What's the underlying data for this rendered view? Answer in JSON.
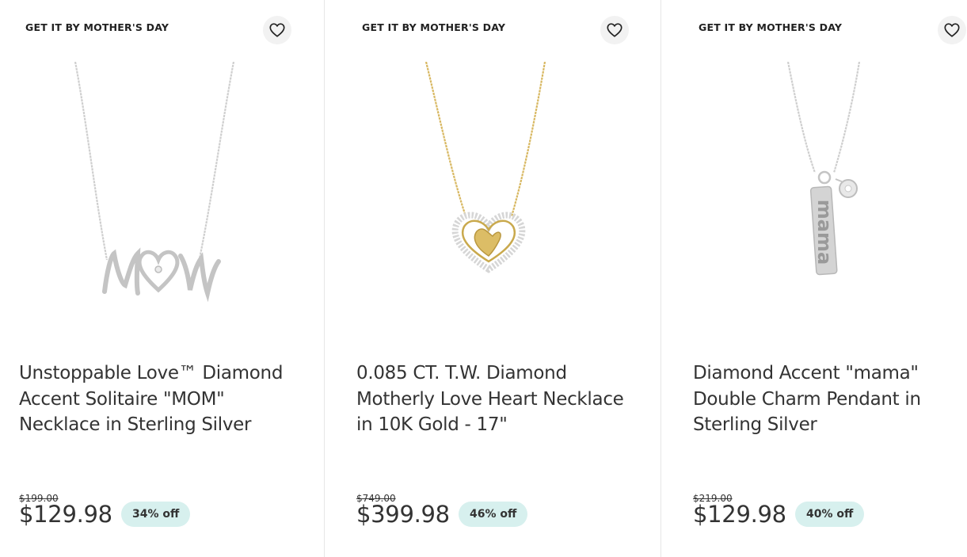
{
  "products": [
    {
      "badge": "GET IT BY MOTHER'S DAY",
      "title": "Unstoppable Love™ Diamond Accent Solitaire \"MOM\" Necklace in Sterling Silver",
      "original_price": "$199.00",
      "price": "$129.98",
      "discount": "34% off",
      "icon": "heart-icon"
    },
    {
      "badge": "GET IT BY MOTHER'S DAY",
      "title": "0.085 CT. T.W. Diamond Motherly Love Heart Necklace in 10K Gold - 17\"",
      "original_price": "$749.00",
      "price": "$399.98",
      "discount": "46% off",
      "icon": "heart-icon"
    },
    {
      "badge": "GET IT BY MOTHER'S DAY",
      "title": "Diamond Accent \"mama\" Double Charm Pendant in Sterling Silver",
      "original_price": "$219.00",
      "price": "$129.98",
      "discount": "40% off",
      "icon": "heart-icon"
    }
  ],
  "colors": {
    "discount_bg": "#d7f0ee",
    "silver": "#c8c8c8",
    "gold": "#d8b862"
  }
}
